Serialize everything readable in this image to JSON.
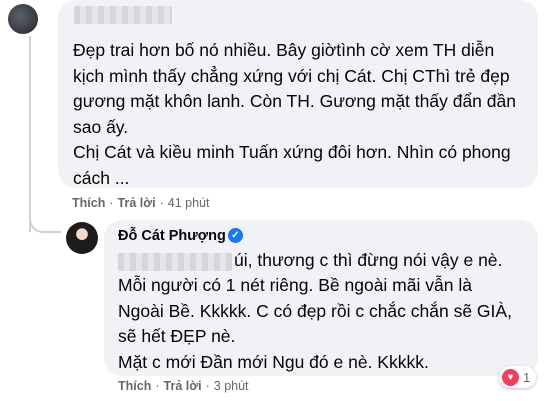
{
  "comment": {
    "text": "Đẹp trai hơn bố nó nhiều. Bây giờtình cờ xem TH diễn\nkịch mình thấy chẳng xứng với chị Cát. Chị CThì trẻ đẹp\ngương mặt khôn lanh. Còn TH. Gương mặt thấy đẩn đần\nsao ấy.\nChị Cát và kiều minh Tuấn xứng đôi hơn. Nhìn có phong\ncách ...",
    "like_label": "Thích",
    "reply_label": "Trả lời",
    "time": "41 phút"
  },
  "reply": {
    "author": "Đỗ Cát Phượng",
    "text_first": "úi, thương c thì đừng nói vậy e nè.",
    "text_rest": "Mỗi người có 1 nét riêng. Bề ngoài mãi vẫn là\nNgoài Bề. Kkkkk. C có đẹp rồi c chắc chắn sẽ GIÀ,\nsẽ hết ĐẸP nè.\nMặt c mới Đần mới Ngu đó e nè. Kkkkk.",
    "like_label": "Thích",
    "reply_label": "Trả lời",
    "time": "3 phút",
    "reaction_count": "1",
    "reaction_icon": "heart-icon",
    "verified_icon": "verified-badge-icon"
  },
  "colors": {
    "bubble": "#f0f2f5",
    "verified": "#1877f2",
    "heart": "#f33e58",
    "meta": "#65676b"
  }
}
